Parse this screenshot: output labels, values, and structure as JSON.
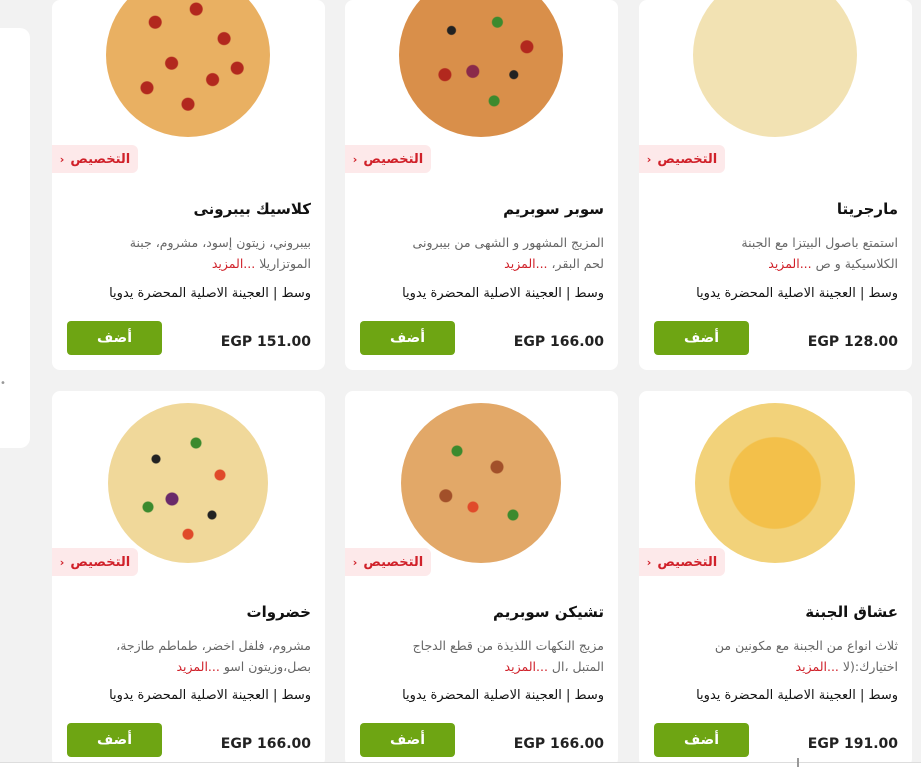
{
  "customize_label": "التخصيص",
  "more_label": "...المزيد",
  "add_label": "أضف",
  "variant_label": "وسط | العجينة الاصلية المحضرة يدويا",
  "products": [
    {
      "title": "مارجريتا",
      "desc1": "استمتع باصول البيتزا مع الجبنة",
      "desc2": "الكلاسيكية و ص",
      "price": "EGP 128.00",
      "image": "margherita-pizza"
    },
    {
      "title": "سوبر سوبريم",
      "desc1": "المزيج المشهور و الشهى من بيبرونى",
      "desc2": "لحم البقر،",
      "price": "EGP 166.00",
      "image": "super-supreme-pizza"
    },
    {
      "title": "كلاسيك بيبرونى",
      "desc1": "بيبروني، زيتون إسود، مشروم، جبنة",
      "desc2": "الموتزاريلا",
      "price": "EGP 151.00",
      "image": "pepperoni-pizza"
    },
    {
      "title": "عشاق الجبنة",
      "desc1": "ثلاث انواع من الجبنة مع مكونين من",
      "desc2": "اختيارك:(لا",
      "price": "EGP 191.00",
      "image": "cheese-lovers-pizza"
    },
    {
      "title": "تشيكن سوبريم",
      "desc1": "مزيج النكهات اللذيذة من قطع الدجاج",
      "desc2": "المتبل ،ال",
      "price": "EGP 166.00",
      "image": "chicken-supreme-pizza"
    },
    {
      "title": "خضروات",
      "desc1": "مشروم، فلفل اخضر، طماطم طازجة،",
      "desc2": "بصل،وزيتون اسو",
      "price": "EGP 166.00",
      "image": "veggie-pizza"
    }
  ]
}
